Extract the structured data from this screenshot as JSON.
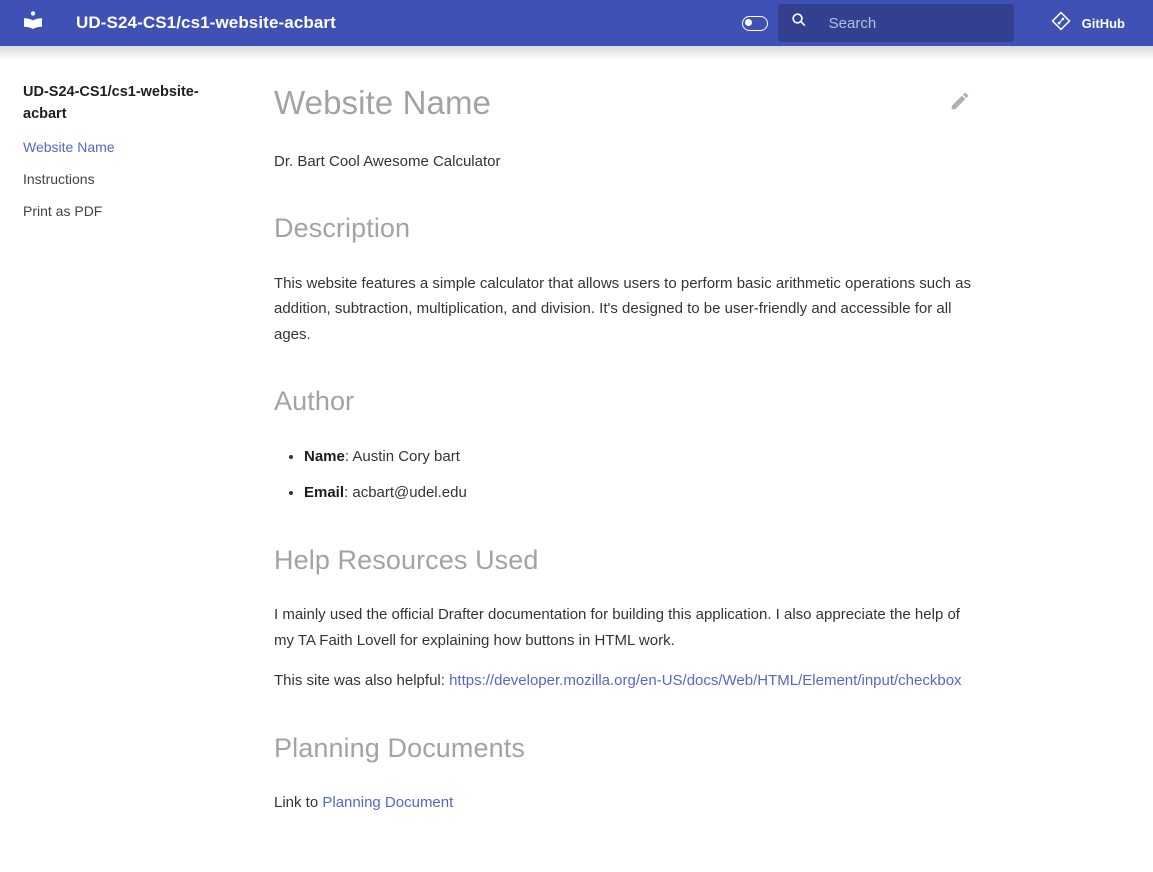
{
  "header": {
    "logo_icon": "library-book-icon",
    "site_title": "UD-S24-CS1/cs1-website-acbart",
    "palette_toggle_icon": "toggle-switch-icon",
    "search": {
      "icon": "search-icon",
      "placeholder": "Search",
      "value": ""
    },
    "repo": {
      "icon": "git-diamond-icon",
      "label": "GitHub"
    },
    "background_color": "#3f51b5",
    "search_background_color": "#32408f"
  },
  "sidebar": {
    "title": "UD-S24-CS1/cs1-website-acbart",
    "items": [
      {
        "label": "Website Name",
        "active": true
      },
      {
        "label": "Instructions",
        "active": false
      },
      {
        "label": "Print as PDF",
        "active": false
      }
    ],
    "active_color": "#5667c9"
  },
  "main": {
    "page_title": "Website Name",
    "edit_icon": "pencil-edit-icon",
    "intro_text": "Dr. Bart Cool Awesome Calculator",
    "sections": {
      "description": {
        "heading": "Description",
        "paragraph": "This website features a simple calculator that allows users to perform basic arithmetic operations such as addition, subtraction, multiplication, and division. It's designed to be user-friendly and accessible for all ages."
      },
      "author": {
        "heading": "Author",
        "items": [
          {
            "label": "Name",
            "value": ": Austin Cory bart"
          },
          {
            "label": "Email",
            "value": ": acbart@udel.edu"
          }
        ]
      },
      "help_resources": {
        "heading": "Help Resources Used",
        "paragraph": "I mainly used the official Drafter documentation for building this application. I also appreciate the help of my TA Faith Lovell for explaining how buttons in HTML work.",
        "link_prefix": "This site was also helpful: ",
        "link_text": "https://developer.mozilla.org/en-US/docs/Web/HTML/Element/input/checkbox"
      },
      "planning": {
        "heading": "Planning Documents",
        "link_prefix": "Link to ",
        "link_text": "Planning Document"
      }
    },
    "heading_color": "#a3a3a3",
    "link_color": "#5667c9"
  }
}
